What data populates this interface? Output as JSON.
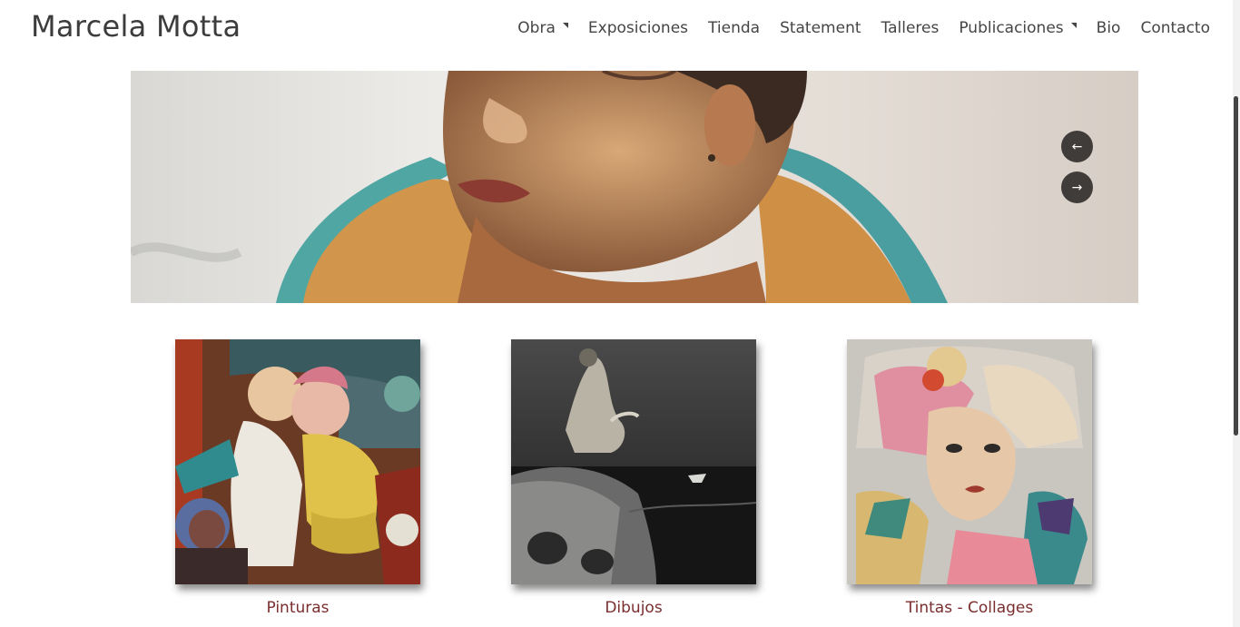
{
  "site": {
    "title": "Marcela Motta"
  },
  "nav": {
    "items": [
      {
        "label": "Obra",
        "has_submenu": true
      },
      {
        "label": "Exposiciones",
        "has_submenu": false
      },
      {
        "label": "Tienda",
        "has_submenu": false
      },
      {
        "label": "Statement",
        "has_submenu": false
      },
      {
        "label": "Talleres",
        "has_submenu": false
      },
      {
        "label": "Publicaciones",
        "has_submenu": true
      },
      {
        "label": "Bio",
        "has_submenu": false
      },
      {
        "label": "Contacto",
        "has_submenu": false
      }
    ]
  },
  "slider": {
    "prev_icon": "arrow-left-icon",
    "next_icon": "arrow-right-icon",
    "prev_glyph": "←",
    "next_glyph": "→"
  },
  "gallery": [
    {
      "caption": "Pinturas"
    },
    {
      "caption": "Dibujos"
    },
    {
      "caption": "Tintas - Collages"
    }
  ],
  "colors": {
    "caption": "#7a2e2e",
    "slider_button": "#403c39",
    "text": "#454545"
  }
}
